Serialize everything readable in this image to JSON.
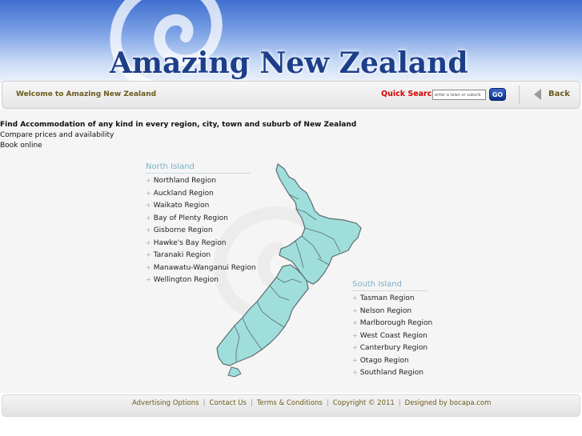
{
  "header": {
    "site_title": "Amazing New Zealand"
  },
  "navbar": {
    "welcome": "Welcome to Amazing New Zealand",
    "quick_search_label": "Quick Search",
    "search_placeholder": "enter a town or suburb",
    "go_label": "GO",
    "back_label": "Back"
  },
  "intro": {
    "line1": "Find Accommodation of any kind in every region, city, town and suburb of New Zealand",
    "line2": "Compare prices and availability",
    "line3": "Book online"
  },
  "north_island": {
    "heading": "North Island",
    "regions": [
      "Northland Region",
      "Auckland Region",
      "Waikato Region",
      "Bay of Plenty Region",
      "Gisborne Region",
      "Hawke's Bay Region",
      "Taranaki Region",
      "Manawatu-Wanganui Region",
      "Wellington Region"
    ]
  },
  "south_island": {
    "heading": "South Island",
    "regions": [
      "Tasman Region",
      "Nelson Region",
      "Marlborough Region",
      "West Coast Region",
      "Canterbury Region",
      "Otago Region",
      "Southland Region"
    ]
  },
  "footer": {
    "links": [
      "Advertising Options",
      "Contact Us",
      "Terms & Conditions",
      "Copyright © 2011",
      "Designed by bocapa.com"
    ],
    "separator": "|"
  },
  "colors": {
    "map_fill": "#9fdedb",
    "map_stroke": "#5d6b70",
    "title": "#1d3f8a",
    "link_gold": "#6b5a1a",
    "quick_search_red": "#d40000"
  },
  "icons": {
    "back": "back-arrow-icon",
    "go": "go-button",
    "koru": "koru-swirl"
  }
}
